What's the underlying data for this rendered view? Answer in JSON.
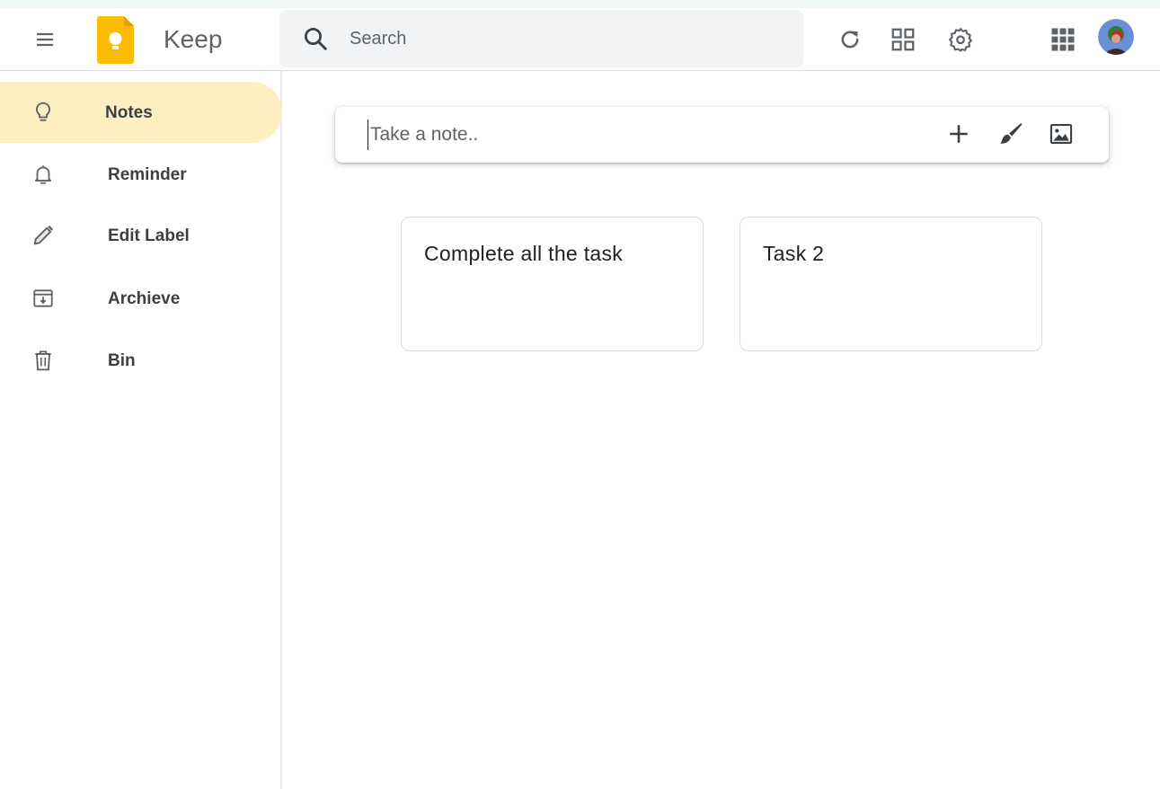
{
  "app": {
    "title": "Keep",
    "brand_color": "#fbbc04"
  },
  "header": {
    "menu_icon": "hamburger-menu-icon",
    "search": {
      "placeholder": "Search",
      "value": ""
    },
    "actions": [
      "refresh-icon",
      "grid-view-icon",
      "settings-gear-icon",
      "apps-grid-icon",
      "avatar"
    ]
  },
  "sidebar": {
    "items": [
      {
        "label": "Notes",
        "icon": "lightbulb-icon",
        "active": true
      },
      {
        "label": "Reminder",
        "icon": "bell-icon",
        "active": false
      },
      {
        "label": "Edit Label",
        "icon": "pencil-icon",
        "active": false
      },
      {
        "label": "Archieve",
        "icon": "archive-icon",
        "active": false
      },
      {
        "label": "Bin",
        "icon": "trash-icon",
        "active": false
      }
    ],
    "active_color": "#feefc3"
  },
  "note_composer": {
    "placeholder": "Take a note..",
    "value": "",
    "actions": [
      "plus-icon",
      "paintbrush-icon",
      "image-icon"
    ]
  },
  "notes": [
    {
      "title": "Complete all the task"
    },
    {
      "title": "Task 2"
    }
  ]
}
